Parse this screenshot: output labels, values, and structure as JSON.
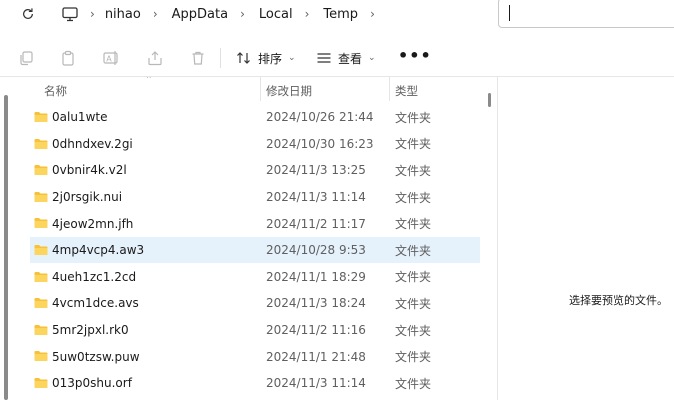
{
  "address_bar": {
    "breadcrumbs": [
      "nihao",
      "AppData",
      "Local",
      "Temp"
    ],
    "search_value": ""
  },
  "command_bar": {
    "sort_label": "排序",
    "view_label": "查看",
    "more_label": "•••"
  },
  "columns": {
    "name": "名称",
    "modified": "修改日期",
    "type": "类型"
  },
  "files": [
    {
      "name": "0alu1wte",
      "modified": "2024/10/26 21:44",
      "type": "文件夹"
    },
    {
      "name": "0dhndxev.2gi",
      "modified": "2024/10/30 16:23",
      "type": "文件夹"
    },
    {
      "name": "0vbnir4k.v2l",
      "modified": "2024/11/3 13:25",
      "type": "文件夹"
    },
    {
      "name": "2j0rsgik.nui",
      "modified": "2024/11/3 11:14",
      "type": "文件夹"
    },
    {
      "name": "4jeow2mn.jfh",
      "modified": "2024/11/2 11:17",
      "type": "文件夹"
    },
    {
      "name": "4mp4vcp4.aw3",
      "modified": "2024/10/28 9:53",
      "type": "文件夹",
      "selected": true
    },
    {
      "name": "4ueh1zc1.2cd",
      "modified": "2024/11/1 18:29",
      "type": "文件夹"
    },
    {
      "name": "4vcm1dce.avs",
      "modified": "2024/11/3 18:24",
      "type": "文件夹"
    },
    {
      "name": "5mr2jpxl.rk0",
      "modified": "2024/11/2 11:16",
      "type": "文件夹"
    },
    {
      "name": "5uw0tzsw.puw",
      "modified": "2024/11/1 21:48",
      "type": "文件夹"
    },
    {
      "name": "013p0shu.orf",
      "modified": "2024/11/3 11:14",
      "type": "文件夹"
    }
  ],
  "preview": {
    "message": "选择要预览的文件。"
  },
  "colors": {
    "accent_folder": "#f7c23a",
    "selection": "#e5f1fb"
  }
}
